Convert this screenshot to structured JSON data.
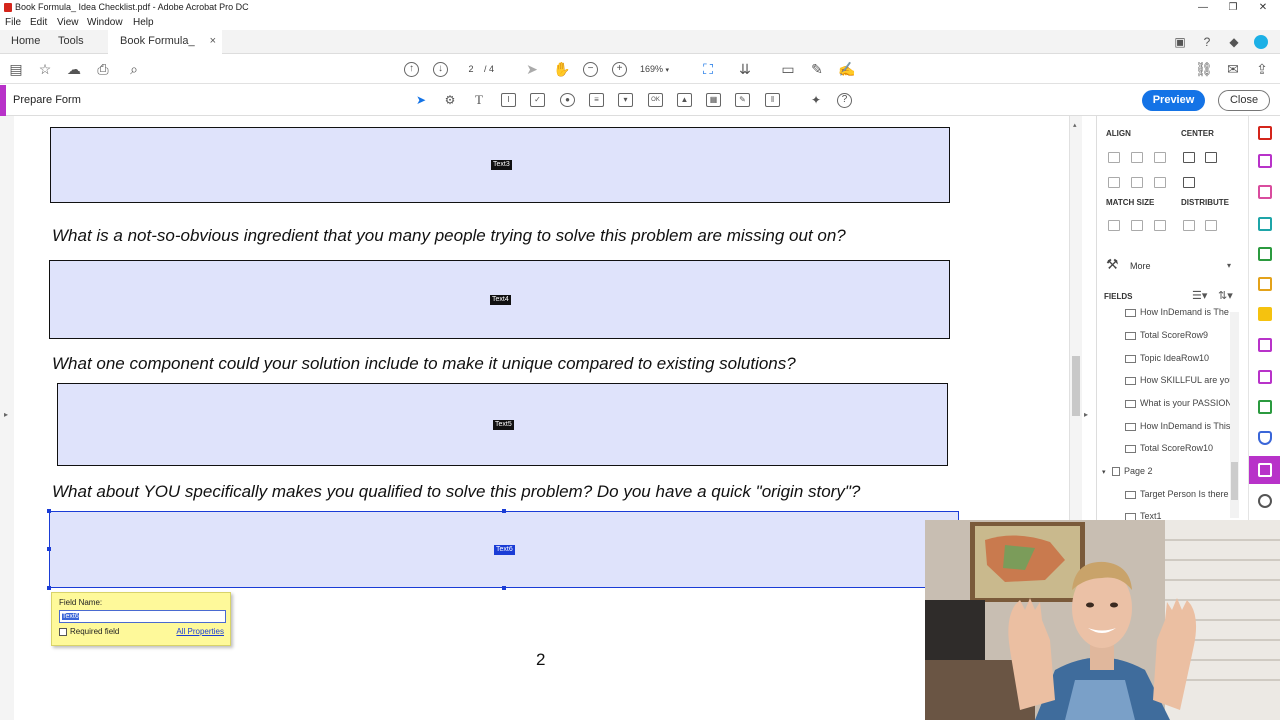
{
  "window": {
    "title": "Book Formula_ Idea Checklist.pdf - Adobe Acrobat Pro DC",
    "controls": {
      "minimize": "—",
      "restore": "❐",
      "close": "✕"
    }
  },
  "menu": [
    "File",
    "Edit",
    "View",
    "Window",
    "Help"
  ],
  "tabs": {
    "home": "Home",
    "tools": "Tools",
    "document": "Book Formula_ Ide...",
    "document_close": "×"
  },
  "toolbar": {
    "page_current": "2",
    "page_total": "/ 4",
    "zoom": "169%"
  },
  "prepare_form": {
    "title": "Prepare Form",
    "preview": "Preview",
    "close": "Close"
  },
  "document": {
    "questions": [
      "What is a not-so-obvious ingredient that you many people trying to solve this problem are missing out on?",
      "What one component could your solution include to make it unique compared to existing solutions?",
      "What about YOU specifically makes you qualified to solve this problem? Do you have a quick \"origin story\"?"
    ],
    "fields": [
      "Text3",
      "Text4",
      "Text5",
      "Text6"
    ],
    "page_number": "2"
  },
  "field_popup": {
    "label": "Field Name:",
    "value": "Text6",
    "required": "Required field",
    "all_properties": "All Properties"
  },
  "panel": {
    "align": "ALIGN",
    "center": "CENTER",
    "match_size": "MATCH SIZE",
    "distribute": "DISTRIBUTE",
    "more": "More",
    "fields_title": "FIELDS",
    "fields_list": [
      "How InDemand is The",
      "Total ScoreRow9",
      "Topic IdeaRow10",
      "How SKILLFUL are you",
      "What is your PASSION",
      "How InDemand is This",
      "Total ScoreRow10"
    ],
    "page_group": "Page 2",
    "page2_fields": [
      "Target Person Is there",
      "Text1"
    ]
  },
  "colors": {
    "accent": "#b832c9",
    "primary": "#1473e6",
    "field_fill": "#dfe3fb",
    "selection": "#1a3cd6"
  }
}
